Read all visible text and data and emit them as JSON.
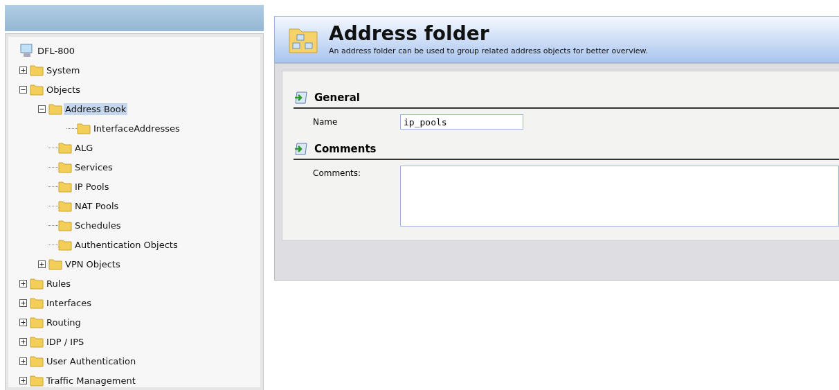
{
  "tree": {
    "label": "DFL-800",
    "children": [
      {
        "label": "System",
        "expanded": false,
        "selected": false
      },
      {
        "label": "Objects",
        "expanded": true,
        "selected": false,
        "children": [
          {
            "label": "Address Book",
            "expanded": true,
            "selected": true,
            "children": [
              {
                "label": "InterfaceAddresses",
                "selected": false
              }
            ]
          },
          {
            "label": "ALG",
            "selected": false
          },
          {
            "label": "Services",
            "selected": false
          },
          {
            "label": "IP Pools",
            "selected": false
          },
          {
            "label": "NAT Pools",
            "selected": false
          },
          {
            "label": "Schedules",
            "selected": false
          },
          {
            "label": "Authentication Objects",
            "selected": false
          },
          {
            "label": "VPN Objects",
            "expanded": false,
            "selected": false
          }
        ]
      },
      {
        "label": "Rules",
        "expanded": false,
        "selected": false
      },
      {
        "label": "Interfaces",
        "expanded": false,
        "selected": false
      },
      {
        "label": "Routing",
        "expanded": false,
        "selected": false
      },
      {
        "label": "IDP / IPS",
        "expanded": false,
        "selected": false
      },
      {
        "label": "User Authentication",
        "expanded": false,
        "selected": false
      },
      {
        "label": "Traffic Management",
        "expanded": false,
        "selected": false
      }
    ]
  },
  "header": {
    "title": "Address folder",
    "subtitle": "An address folder can be used to group related address objects for better overview."
  },
  "sections": [
    {
      "title": "General",
      "kind": "input",
      "label": "Name",
      "value": "ip_pools"
    },
    {
      "title": "Comments",
      "kind": "textarea",
      "label": "Comments:"
    }
  ]
}
